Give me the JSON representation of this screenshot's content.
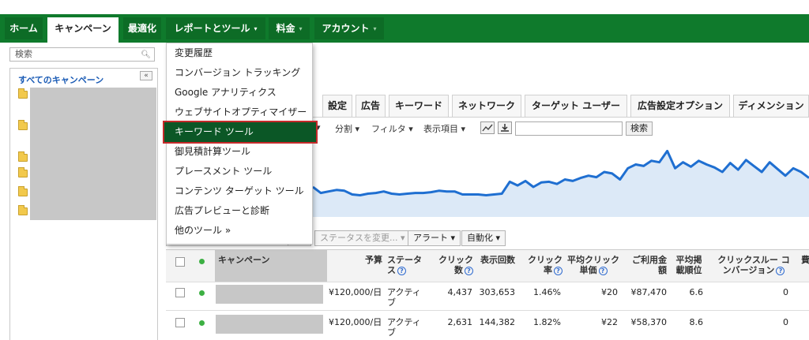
{
  "nav": {
    "tabs": [
      {
        "label": "ホーム"
      },
      {
        "label": "キャンペーン"
      },
      {
        "label": "最適化"
      },
      {
        "label": "レポートとツール"
      },
      {
        "label": "料金"
      },
      {
        "label": "アカウント"
      }
    ],
    "caret": "▾"
  },
  "left": {
    "search_placeholder": "検索",
    "all_campaigns": "すべてのキャンペーン",
    "collapse": "«"
  },
  "dropdown": {
    "items": [
      "変更履歴",
      "コンバージョン トラッキング",
      "Google アナリティクス",
      "ウェブサイトオプティマイザー",
      "キーワード ツール",
      "御見積計算ツール",
      "プレースメント ツール",
      "コンテンツ ターゲット ツール",
      "広告プレビューと診断",
      "他のツール »"
    ],
    "highlighted_index": 4
  },
  "subtabs": [
    "設定",
    "広告",
    "キーワード",
    "ネットワーク",
    "ターゲット ユーザー",
    "広告設定オプション",
    "ディメンション"
  ],
  "toolbar": {
    "segment": "分割 ▾",
    "filter": "フィルタ ▾",
    "columns": "表示項目 ▾",
    "chart_icon": "chart-icon",
    "download_icon": "download-icon",
    "search_button": "検索"
  },
  "chart_data": {
    "type": "area",
    "color": "#1f6fd1",
    "fill": "#dce9f7",
    "values": [
      40,
      32,
      34,
      36,
      35,
      30,
      29,
      31,
      32,
      34,
      31,
      30,
      31,
      32,
      32,
      33,
      35,
      34,
      34,
      30,
      30,
      30,
      29,
      30,
      31,
      47,
      42,
      48,
      40,
      46,
      47,
      44,
      50,
      48,
      52,
      55,
      53,
      60,
      58,
      50,
      65,
      70,
      68,
      75,
      73,
      88,
      65,
      73,
      67,
      75,
      70,
      66,
      60,
      72,
      63,
      76,
      68,
      60,
      73,
      64,
      55,
      65,
      60,
      52
    ]
  },
  "actions": {
    "status_change": "ステータスを変更... ▾",
    "alerts": "アラート ▾",
    "automate": "自動化 ▾"
  },
  "table": {
    "headers": {
      "campaign": "キャンペーン",
      "budget": "予算",
      "status_l1": "ステータ",
      "status_l2": "ス",
      "clicks_l1": "クリック",
      "clicks_l2": "数",
      "impressions": "表示回数",
      "ctr_l1": "クリック",
      "ctr_l2": "率",
      "cpc_l1": "平均クリック",
      "cpc_l2": "単価",
      "cost_l1": "ご利用金",
      "cost_l2": "額",
      "pos_l1": "平均掲",
      "pos_l2": "載順位",
      "conv_l1": "クリックスルー コ",
      "conv_l2": "ンバージョン",
      "more": "費"
    },
    "help": "?",
    "rows": [
      {
        "budget": "¥120,000/日",
        "status_l1": "アクティ",
        "status_l2": "ブ",
        "clicks": "4,437",
        "impressions": "303,653",
        "ctr": "1.46%",
        "cpc": "¥20",
        "cost": "¥87,470",
        "pos": "6.6",
        "conv": "0"
      },
      {
        "budget": "¥120,000/日",
        "status_l1": "アクティ",
        "status_l2": "ブ",
        "clicks": "2,631",
        "impressions": "144,382",
        "ctr": "1.82%",
        "cpc": "¥22",
        "cost": "¥58,370",
        "pos": "8.6",
        "conv": "0"
      }
    ]
  }
}
